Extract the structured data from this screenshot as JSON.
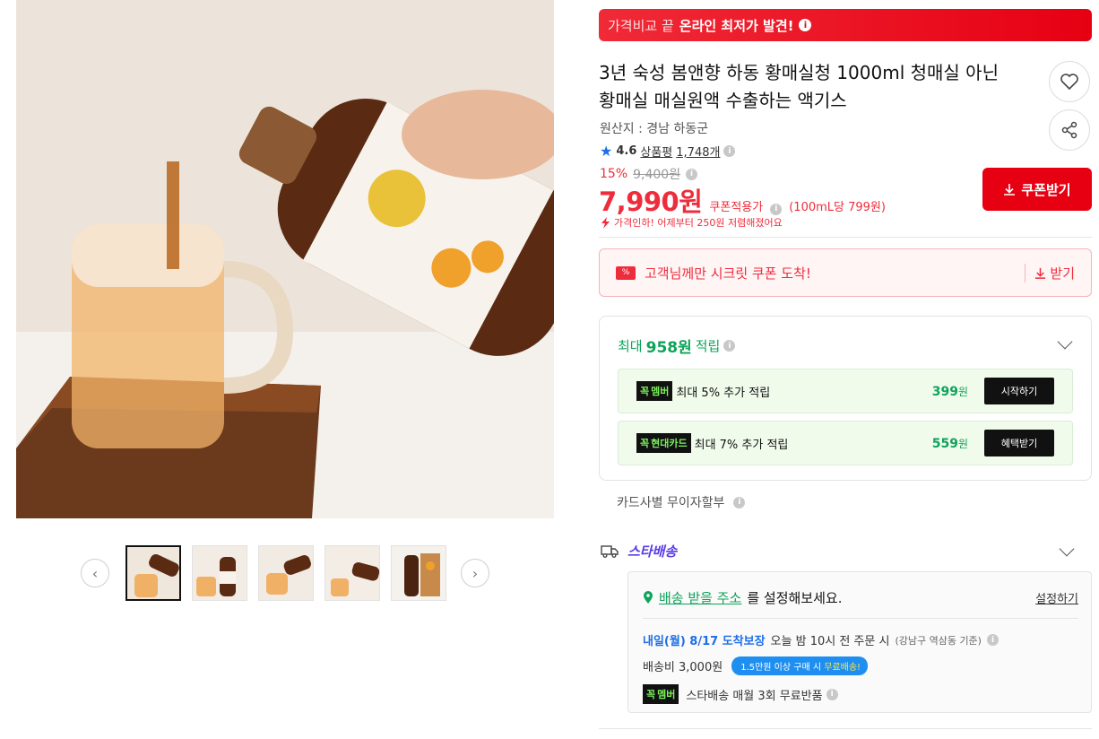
{
  "banner": {
    "light": "가격비교 끝",
    "strong": "온라인 최저가 발견!"
  },
  "product": {
    "title_line1": "3년 숙성 봄앤향 하동 황매실청 1000ml 청매실 아닌",
    "title_line2": "황매실 매실원액 수출하는 액기스",
    "origin": "원산지 : 경남 하동군",
    "rating": "4.6",
    "review_label": "상품평",
    "review_count": "1,748개",
    "discount_pct": "15%",
    "original_price": "9,400원",
    "price": "7,990원",
    "price_label": "쿠폰적용가",
    "unit_price": "(100mL당 799원)",
    "price_drop_note": "가격인하! 어제부터 250원 저렴해졌어요"
  },
  "coupon_button": "쿠폰받기",
  "secret_coupon": {
    "text": "고객님께만 시크릿 쿠폰 도착!",
    "get": "받기"
  },
  "rewards": {
    "head_prefix": "최대",
    "head_amount": "958원",
    "head_suffix": "적립",
    "items": [
      {
        "badge_prefix": "꼭",
        "badge": "멤버",
        "text": "최대 5% 추가 적립",
        "amount": "399",
        "unit": "원",
        "button": "시작하기"
      },
      {
        "badge_prefix": "꼭",
        "badge": "현대카드",
        "text": "최대 7% 추가 적립",
        "amount": "559",
        "unit": "원",
        "button": "혜택받기"
      }
    ]
  },
  "installment": "카드사별 무이자할부",
  "shipping": {
    "brand": "스타배송",
    "address_link": "배송 받을 주소",
    "address_suffix": "를 설정해보세요.",
    "set_label": "설정하기",
    "eta_date": "내일(월) 8/17 도착보장",
    "eta_text": "오늘 밤 10시 전 주문 시",
    "eta_note": "(강남구 역삼동 기준)",
    "fee": "배송비 3,000원",
    "free_tag_prefix": "1.5만원 이상 구매 시",
    "free_tag_strong": "무료배송!",
    "return_badge_prefix": "꼭",
    "return_badge": "멤버",
    "return_text": "스타배송 매월 3회 무료반품"
  },
  "colors": {
    "accent_red": "#e60012",
    "green": "#0ea35a",
    "blue": "#1e6ee8",
    "purple": "#5a3be8"
  },
  "icons": [
    "info-icon",
    "heart-icon",
    "share-icon",
    "star-icon",
    "download-icon",
    "coupon-icon",
    "chevron-down-icon",
    "truck-icon",
    "location-pin-icon",
    "chevron-left-icon",
    "chevron-right-icon"
  ]
}
